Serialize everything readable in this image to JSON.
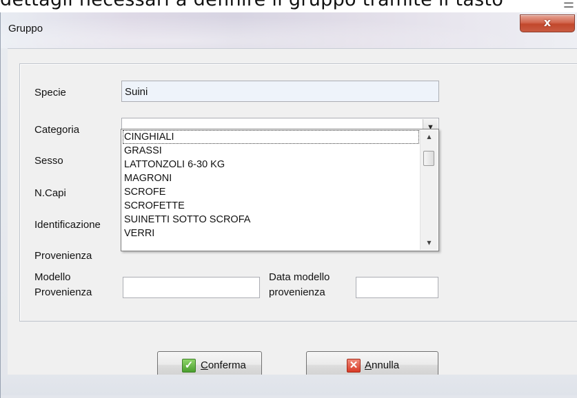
{
  "document": {
    "text_behind": "dettagli necessari a definire il gruppo tramite il tasto",
    "scroll_glyph": "☰"
  },
  "dialog": {
    "title": "Gruppo",
    "close_label": "x"
  },
  "form": {
    "specie": {
      "label": "Specie",
      "value": "Suini"
    },
    "categoria": {
      "label": "Categoria",
      "value": ""
    },
    "sesso": {
      "label": "Sesso"
    },
    "n_capi": {
      "label": "N.Capi"
    },
    "identificazione": {
      "label": "Identificazione"
    },
    "provenienza": {
      "label": "Provenienza"
    },
    "modello_provenienza": {
      "label_line1": "Modello",
      "label_line2": "Provenienza",
      "value": ""
    },
    "data_modello_provenienza": {
      "label_line1": "Data modello",
      "label_line2": "provenienza",
      "value": ""
    }
  },
  "categoria_dropdown": {
    "selected_index": 0,
    "items": [
      "CINGHIALI",
      "GRASSI",
      "LATTONZOLI 6-30 KG",
      "MAGRONI",
      "SCROFE",
      "SCROFETTE",
      "SUINETTI SOTTO SCROFA",
      "VERRI"
    ]
  },
  "buttons": {
    "confirm": {
      "accel": "C",
      "rest": "onferma",
      "icon": "check-icon"
    },
    "cancel": {
      "accel": "A",
      "rest": "nnulla",
      "icon": "x-icon"
    }
  },
  "colors": {
    "close_button": "#c7533a",
    "confirm_icon": "#5cb23b",
    "cancel_icon": "#d83a26",
    "readonly_field": "#eef3fa"
  }
}
